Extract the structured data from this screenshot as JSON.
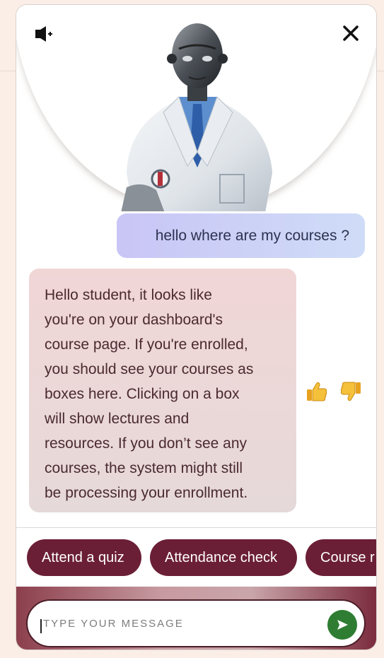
{
  "chat": {
    "user_message": "hello where are my courses ?",
    "bot_message_lines": [
      "Hello student, it looks like",
      "you're on your dashboard's",
      "course page. If you're enrolled,",
      "you should see your courses as",
      "boxes here. Clicking on a box",
      "will show lectures and",
      "resources. If you don’t see any",
      "courses, the system might still",
      "be processing your enrollment."
    ]
  },
  "quick_replies": [
    "Attend a quiz",
    "Attendance check",
    "Course r"
  ],
  "input": {
    "placeholder": "TYPE YOUR MESSAGE",
    "value": ""
  },
  "icons": {
    "header_left": "speaker-icon",
    "header_right": "close-icon",
    "feedback": [
      "thumbs-up-icon",
      "thumbs-down-icon"
    ],
    "send": "send-icon"
  },
  "colors": {
    "chip": "#6b1f36",
    "send_button": "#2e7d32",
    "user_bubble": "#cfd2f6",
    "bot_bubble": "#efd8d8"
  }
}
